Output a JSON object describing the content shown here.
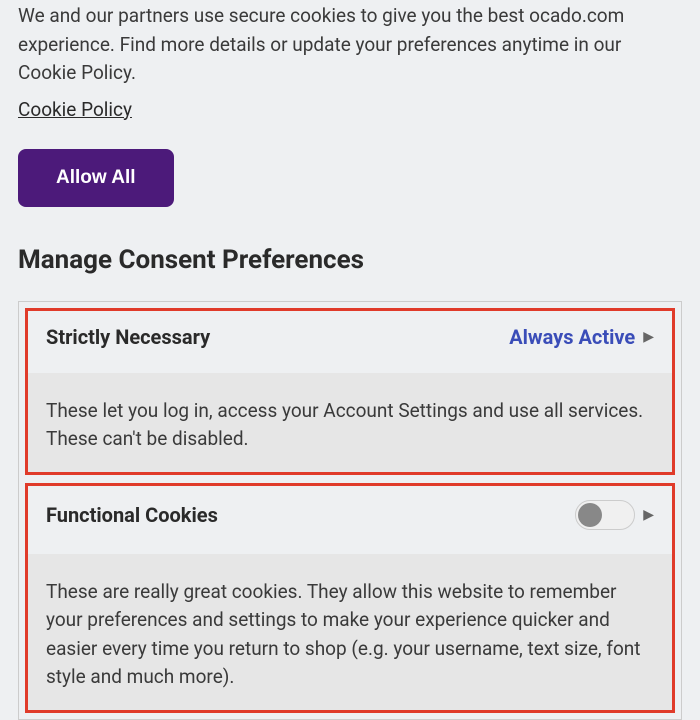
{
  "intro": "We and our partners use secure cookies to give you the best ocado.com experience. Find more details or update your preferences anytime in our Cookie Policy.",
  "cookie_policy_link": "Cookie Policy",
  "allow_all_label": "Allow All",
  "section_heading": "Manage Consent Preferences",
  "categories": [
    {
      "title": "Strictly Necessary",
      "status_label": "Always Active",
      "description": "These let you log in, access your Account Settings and use all services. These can't be disabled."
    },
    {
      "title": "Functional Cookies",
      "description": "These are really great cookies. They allow this website to remember your preferences and settings to make your experience quicker and easier every time you return to shop (e.g. your username, text size, font style and much more)."
    }
  ]
}
